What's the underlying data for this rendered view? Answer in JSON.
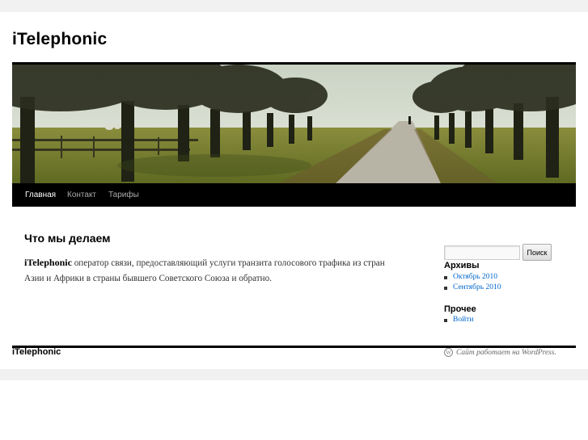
{
  "site": {
    "title": "iTelephonic"
  },
  "nav": {
    "items": [
      {
        "label": "Главная",
        "current": true
      },
      {
        "label": "Контакт",
        "current": false
      },
      {
        "label": "Тарифы",
        "current": false
      }
    ]
  },
  "post": {
    "title": "Что мы делаем",
    "brand": "iTelephonic",
    "line1_rest": " оператор связи, предоставляющий услуги транзита голосового трафика из стран",
    "line2": "Азии и Африки в страны бывшего Советского Союза и обратно."
  },
  "sidebar": {
    "search": {
      "value": "",
      "button_label": "Поиск"
    },
    "archives": {
      "title": "Архивы",
      "items": [
        "Октябрь 2010",
        "Сентябрь 2010"
      ]
    },
    "misc": {
      "title": "Прочее",
      "items": [
        "Войти"
      ]
    }
  },
  "footer": {
    "site_title": "iTelephonic",
    "powered_by": "Сайт работает на WordPress."
  },
  "icons": {
    "powered": "wordpress-icon"
  }
}
